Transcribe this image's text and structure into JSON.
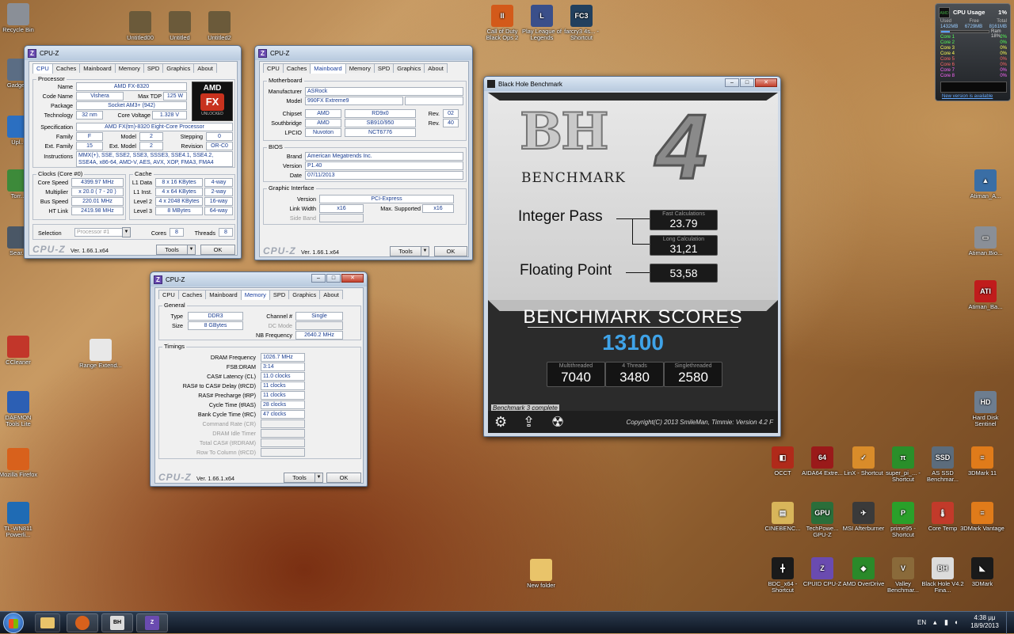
{
  "desktop": {
    "left_icons": [
      {
        "label": "Recycle Bin",
        "icon": "recycle-bin-icon",
        "color": "#8a8f97"
      },
      {
        "label": "Gadgets",
        "icon": "gadgets-icon",
        "color": "#5b6d84"
      },
      {
        "label": "Upl...",
        "icon": "upload-icon",
        "color": "#2b6fc1"
      },
      {
        "label": "Torr...",
        "icon": "torrent-icon",
        "color": "#3d8a3a"
      },
      {
        "label": "Sear...",
        "icon": "search-icon",
        "color": "#4a5766"
      },
      {
        "label": "CCleaner",
        "icon": "ccleaner-icon",
        "color": "#c2362a"
      },
      {
        "label": "DAEMON Tools Lite",
        "icon": "daemon-tools-icon",
        "color": "#2c5fb4"
      },
      {
        "label": "Mozilla Firefox",
        "icon": "firefox-icon",
        "color": "#d8611c"
      },
      {
        "label": "TL-WN811 Powerli...",
        "icon": "tplink-icon",
        "color": "#1f6bb4"
      }
    ],
    "top_icons": [
      {
        "label": "Untitled00",
        "icon": "image-file-icon"
      },
      {
        "label": "Untitled",
        "icon": "image-file-icon"
      },
      {
        "label": "Untitled2",
        "icon": "image-file-icon"
      }
    ],
    "game_icons": [
      {
        "label": "Call of Duty Black Ops 2",
        "icon": "cod-icon",
        "color": "#d35a1a",
        "glyph": "II"
      },
      {
        "label": "Play League of Legends",
        "icon": "lol-icon",
        "color": "#3a4f8a",
        "glyph": "L"
      },
      {
        "label": "farcry3 4s... - Shortcut",
        "icon": "farcry3-icon",
        "color": "#22405e",
        "glyph": "FC3"
      }
    ],
    "misc_icons": [
      {
        "label": "Range Extend...",
        "icon": "document-icon"
      },
      {
        "label": "New folder",
        "icon": "folder-icon"
      }
    ],
    "right_icons": [
      {
        "label": "Atiman_A...",
        "icon": "atiman-icon",
        "color": "#3a6ea5",
        "glyph": "▲"
      },
      {
        "label": "Atiman.Bio...",
        "icon": "usb-drive-icon",
        "color": "#8a8f97",
        "glyph": "▭"
      },
      {
        "label": "Atiman_Ba...",
        "icon": "ati-radeon-icon",
        "color": "#c01c1c",
        "glyph": "ATI"
      },
      {
        "label": "Hard Disk Sentinel",
        "icon": "hdd-sentinel-icon",
        "color": "#6d7d8f",
        "glyph": "HD"
      }
    ],
    "bottom_grid": [
      {
        "label": "OCCT",
        "icon": "occt-icon",
        "color": "#b02a1a",
        "glyph": "◧"
      },
      {
        "label": "AIDA64 Extre...",
        "icon": "aida64-icon",
        "color": "#9a1a1a",
        "glyph": "64"
      },
      {
        "label": "LinX - Shortcut",
        "icon": "linx-icon",
        "color": "#d98c2a",
        "glyph": "✓"
      },
      {
        "label": "super_pi_... - Shortcut",
        "icon": "superpi-icon",
        "color": "#2a8f2a",
        "glyph": "π"
      },
      {
        "label": "AS SSD Benchmar...",
        "icon": "as-ssd-icon",
        "color": "#5c6c7c",
        "glyph": "SSD"
      },
      {
        "label": "3DMark 11",
        "icon": "3dmark11-icon",
        "color": "#e07b1a",
        "glyph": "≡"
      },
      {
        "label": "CINEBENC...",
        "icon": "folder-icon",
        "color": "#d8b55a",
        "glyph": "▤"
      },
      {
        "label": "TechPowe... GPU-Z",
        "icon": "gpuz-icon",
        "color": "#2a6e3a",
        "glyph": "GPU"
      },
      {
        "label": "MSI Afterburner",
        "icon": "afterburner-icon",
        "color": "#3a3a3a",
        "glyph": "✈"
      },
      {
        "label": "prime95 - Shortcut",
        "icon": "prime95-icon",
        "color": "#2aa02a",
        "glyph": "P"
      },
      {
        "label": "Core Temp",
        "icon": "coretemp-icon",
        "color": "#c23a2a",
        "glyph": "🌡"
      },
      {
        "label": "3DMark Vantage",
        "icon": "3dmark-vantage-icon",
        "color": "#e07b1a",
        "glyph": "≡"
      },
      {
        "label": "BDC_x64 - Shortcut",
        "icon": "bdc-icon",
        "color": "#1a1a1a",
        "glyph": "╋"
      },
      {
        "label": "CPUID CPU-Z",
        "icon": "cpuz-icon",
        "color": "#6a4bb0",
        "glyph": "Z"
      },
      {
        "label": "AMD OverDrive",
        "icon": "amd-overdrive-icon",
        "color": "#2a8a2a",
        "glyph": "◆"
      },
      {
        "label": "Valley Benchmar...",
        "icon": "valley-icon",
        "color": "#8a6a3a",
        "glyph": "V"
      },
      {
        "label": "Black Hole V4.2 Fina...",
        "icon": "blackhole-icon",
        "color": "#dcdcdc",
        "glyph": "BH"
      },
      {
        "label": "3DMark",
        "icon": "3dmark-icon",
        "color": "#1a1a1a",
        "glyph": "◣"
      }
    ]
  },
  "gadget": {
    "title": "CPU Usage",
    "percent": "1%",
    "cols": [
      "Used",
      "Free",
      "Total"
    ],
    "vals": [
      "1432MB",
      "6729MB",
      "8161MB"
    ],
    "ram_label": "Ram",
    "ram_pct": "18%",
    "cores": [
      [
        "Core 1",
        "2%"
      ],
      [
        "Core 2",
        "0%"
      ],
      [
        "Core 3",
        "0%"
      ],
      [
        "Core 4",
        "0%"
      ],
      [
        "Core 5",
        "0%"
      ],
      [
        "Core 6",
        "0%"
      ],
      [
        "Core 7",
        "0%"
      ],
      [
        "Core 8",
        "0%"
      ]
    ],
    "update": "New version is available"
  },
  "cpuz1": {
    "title": "CPU-Z",
    "tabs": [
      "CPU",
      "Caches",
      "Mainboard",
      "Memory",
      "SPD",
      "Graphics",
      "About"
    ],
    "group_processor": "Processor",
    "name_l": "Name",
    "name": "AMD FX-8320",
    "codename_l": "Code Name",
    "codename": "Vishera",
    "maxtdp_l": "Max TDP",
    "maxtdp": "125 W",
    "package_l": "Package",
    "package": "Socket AM3+ (942)",
    "tech_l": "Technology",
    "tech": "32 nm",
    "voltage_l": "Core Voltage",
    "voltage": "1.328 V",
    "spec_l": "Specification",
    "spec": "AMD FX(tm)-8320 Eight-Core Processor",
    "family_l": "Family",
    "family": "F",
    "model_l": "Model",
    "model": "2",
    "stepping_l": "Stepping",
    "stepping": "0",
    "extfamily_l": "Ext. Family",
    "extfamily": "15",
    "extmodel_l": "Ext. Model",
    "extmodel": "2",
    "revision_l": "Revision",
    "revision": "OR-C0",
    "instr_l": "Instructions",
    "instr": "MMX(+), SSE, SSE2, SSE3, SSSE3, SSE4.1, SSE4.2, SSE4A, x86-64, AMD-V, AES, AVX, XOP, FMA3, FMA4",
    "group_clocks": "Clocks (Core #0)",
    "corespeed_l": "Core Speed",
    "corespeed": "4399.97 MHz",
    "mult_l": "Multiplier",
    "mult": "x 20.0 ( 7 - 20 )",
    "bus_l": "Bus Speed",
    "bus": "220.01 MHz",
    "ht_l": "HT Link",
    "ht": "2419.98 MHz",
    "group_cache": "Cache",
    "l1d_l": "L1 Data",
    "l1d": "8 x 16 KBytes",
    "l1d_w": "4-way",
    "l1i_l": "L1 Inst.",
    "l1i": "4 x 64 KBytes",
    "l1i_w": "2-way",
    "l2_l": "Level 2",
    "l2": "4 x 2048 KBytes",
    "l2_w": "16-way",
    "l3_l": "Level 3",
    "l3": "8 MBytes",
    "l3_w": "64-way",
    "selection_l": "Selection",
    "selection": "Processor #1",
    "cores_l": "Cores",
    "cores": "8",
    "threads_l": "Threads",
    "threads": "8",
    "brand": "CPU-Z",
    "version": "Ver. 1.66.1.x64",
    "tools": "Tools",
    "ok": "OK",
    "amd_logo": "AMD",
    "fx_logo": "FX",
    "unlocked": "UNLOCKED"
  },
  "cpuz2": {
    "title": "CPU-Z",
    "tabs": [
      "CPU",
      "Caches",
      "Mainboard",
      "Memory",
      "SPD",
      "Graphics",
      "About"
    ],
    "group_mb": "Motherboard",
    "manu_l": "Manufacturer",
    "manu": "ASRock",
    "model_l": "Model",
    "model": "990FX Extreme9",
    "chipset_l": "Chipset",
    "chipset_a": "AMD",
    "chipset_b": "RD9x0",
    "chipset_rev_l": "Rev.",
    "chipset_rev": "02",
    "sb_l": "Southbridge",
    "sb_a": "AMD",
    "sb_b": "SB910/950",
    "sb_rev_l": "Rev.",
    "sb_rev": "40",
    "lpcio_l": "LPCIO",
    "lpcio_a": "Nuvoton",
    "lpcio_b": "NCT6776",
    "group_bios": "BIOS",
    "brand_l": "Brand",
    "brand_v": "American Megatrends Inc.",
    "ver_l": "Version",
    "ver_v": "P1.40",
    "date_l": "Date",
    "date_v": "07/11/2013",
    "group_gi": "Graphic Interface",
    "gi_ver_l": "Version",
    "gi_ver": "PCI-Express",
    "lw_l": "Link Width",
    "lw": "x16",
    "ms_l": "Max. Supported",
    "ms": "x16",
    "sb2_l": "Side Band",
    "brand": "CPU-Z",
    "version": "Ver. 1.66.1.x64",
    "tools": "Tools",
    "ok": "OK"
  },
  "cpuz3": {
    "title": "CPU-Z",
    "tabs": [
      "CPU",
      "Caches",
      "Mainboard",
      "Memory",
      "SPD",
      "Graphics",
      "About"
    ],
    "group_gen": "General",
    "type_l": "Type",
    "type": "DDR3",
    "channel_l": "Channel #",
    "channel": "Single",
    "size_l": "Size",
    "size": "8 GBytes",
    "dcmode_l": "DC Mode",
    "nbfreq_l": "NB Frequency",
    "nbfreq": "2640.2 MHz",
    "group_tim": "Timings",
    "t1_l": "DRAM Frequency",
    "t1": "1026.7 MHz",
    "t2_l": "FSB:DRAM",
    "t2": "3:14",
    "t3_l": "CAS# Latency (CL)",
    "t3": "11.0 clocks",
    "t4_l": "RAS# to CAS# Delay (tRCD)",
    "t4": "11 clocks",
    "t5_l": "RAS# Precharge (tRP)",
    "t5": "11 clocks",
    "t6_l": "Cycle Time (tRAS)",
    "t6": "28 clocks",
    "t7_l": "Bank Cycle Time (tRC)",
    "t7": "47 clocks",
    "t8_l": "Command Rate (CR)",
    "t9_l": "DRAM Idle Timer",
    "t10_l": "Total CAS# (tRDRAM)",
    "t11_l": "Row To Column (tRCD)",
    "brand": "CPU-Z",
    "version": "Ver. 1.66.1.x64",
    "tools": "Tools",
    "ok": "OK"
  },
  "bh": {
    "title": "Black Hole Benchmark",
    "logo_bh": "BH",
    "logo_bench": "BENCHMARK",
    "logo_num": "4",
    "integer_label": "Integer Pass",
    "fast_label": "Fast Calculations",
    "fast_val": "23.79",
    "long_label": "Long Calculation",
    "long_val": "31,21",
    "float_label": "Floating Point",
    "float_val": "53,58",
    "scores_label": "BENCHMARK SCORES",
    "score": "13100",
    "multi_label": "Multithreaded",
    "multi_val": "7040",
    "four_label": "4 Threads",
    "four_val": "3480",
    "single_label": "Singlethreaded",
    "single_val": "2580",
    "status": "Benchmark 3 complete",
    "copyright": "Copyright(C) 2013 SmileMan, Timmie: Version 4.2 F"
  },
  "taskbar": {
    "lang": "EN",
    "time": "4:38 μμ",
    "date": "18/9/2013",
    "apps": [
      {
        "name": "firefox-icon",
        "color": "#d8611c"
      },
      {
        "name": "blackhole-icon",
        "color": "#dcdcdc",
        "glyph": "BH"
      },
      {
        "name": "cpuz-icon",
        "color": "#6a4bb0",
        "glyph": "Z"
      }
    ]
  }
}
